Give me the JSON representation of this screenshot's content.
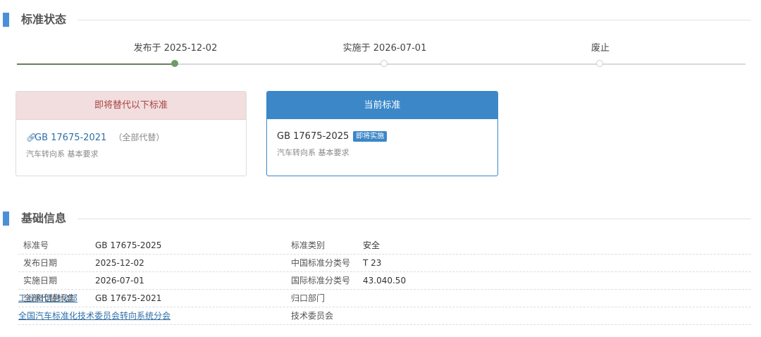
{
  "status_section": {
    "title": "标准状态",
    "timeline": [
      {
        "label": "发布于 2025-12-02",
        "done": true
      },
      {
        "label": "实施于 2026-07-01",
        "done": false
      },
      {
        "label": "废止",
        "done": false
      }
    ]
  },
  "replace_card": {
    "header": "即将替代以下标准",
    "code": "GB 17675-2021",
    "note": "（全部代替）",
    "desc": "汽车转向系 基本要求",
    "icon": "link-icon"
  },
  "current_card": {
    "header": "当前标准",
    "code": "GB 17675-2025",
    "badge": "即将实施",
    "desc": "汽车转向系 基本要求"
  },
  "info_section": {
    "title": "基础信息",
    "rows": [
      {
        "k1": "标准号",
        "v1": "GB 17675-2025",
        "k2": "标准类别",
        "v2": "安全"
      },
      {
        "k1": "发布日期",
        "v1": "2025-12-02",
        "k2": "中国标准分类号",
        "v2": "T 23"
      },
      {
        "k1": "实施日期",
        "v1": "2026-07-01",
        "k2": "国际标准分类号",
        "v2": "43.040.50"
      },
      {
        "k1": "全部代替标准",
        "v1": "GB 17675-2021",
        "k2": "归口部门",
        "v2": "工业和信息化部"
      },
      {
        "k1": "",
        "v1": "",
        "k2": "技术委员会",
        "v2": "全国汽车标准化技术委员会转向系统分会"
      }
    ]
  },
  "colors": {
    "accent": "#3b87c8",
    "section_bar": "#4a90d9",
    "danger_bg": "#f2dede",
    "danger_text": "#a94442",
    "timeline_done": "#6f9a6a"
  }
}
